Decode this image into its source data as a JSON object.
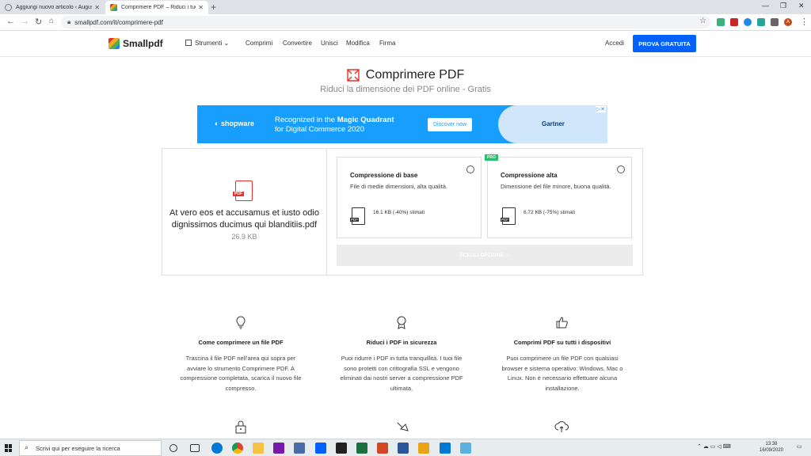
{
  "browser": {
    "tabs": [
      {
        "title": "Aggiungi nuovo articolo ‹ Augus"
      },
      {
        "title": "Comprimere PDF – Riduci i tuoi P"
      }
    ],
    "url": "smallpdf.com/it/comprimere-pdf",
    "profile_initial": "A"
  },
  "site": {
    "logo": "Smallpdf",
    "nav": {
      "tools": "Strumenti",
      "compress": "Comprimi",
      "convert": "Convertire",
      "merge": "Unisci",
      "edit": "Modifica",
      "sign": "Firma"
    },
    "login": "Accedi",
    "cta": "PROVA GRATUITA",
    "accent_color": "#0061fe"
  },
  "page": {
    "title": "Comprimere PDF",
    "subtitle": "Riduci la dimensione dei PDF online - Gratis"
  },
  "ad": {
    "brand": "shopware",
    "line1_prefix": "Recognized in the ",
    "line1_bold": "Magic Quadrant",
    "line2": "for Digital Commerce 2020",
    "button": "Discover now",
    "partner": "Gartner"
  },
  "file": {
    "icon_tag": "PDF",
    "name": "At vero eos et accusamus et iusto odio dignissimos ducimus qui blanditiis.pdf",
    "size": "26.9 KB"
  },
  "options": {
    "basic": {
      "name": "Compressione di base",
      "desc": "File di medie dimensioni, alta qualità.",
      "size": "16.1 KB (-40%) stimati"
    },
    "high": {
      "badge": "PRO",
      "name": "Compressione alta",
      "desc": "Dimensione del file minore, buona qualità.",
      "size": "6.72 KB (-75%) stimati"
    },
    "choose_button": "SCEGLI OPZIONE →"
  },
  "features": [
    {
      "heading": "Come comprimere un file PDF",
      "text": "Trascina il file PDF nell'area qui sopra per avviare lo strumento Comprimere PDF. A compressione completata, scarica il nuovo file compresso."
    },
    {
      "heading": "Riduci i PDF in sicurezza",
      "text": "Puoi ridurre i PDF in tutta tranquillità. I tuoi file sono protetti con crittografia SSL e vengono eliminati dai nostri server a compressione PDF ultimata."
    },
    {
      "heading": "Comprimi PDF su tutti i dispositivi",
      "text": "Puoi comprimere un file PDF con qualsiasi browser e sistema operativo: Windows, Mac o Linux. Non è necessario effettuare alcuna installazione."
    }
  ],
  "taskbar": {
    "search_placeholder": "Scrivi qui per eseguire la ricerca",
    "time": "13:38",
    "date": "16/09/2020"
  }
}
